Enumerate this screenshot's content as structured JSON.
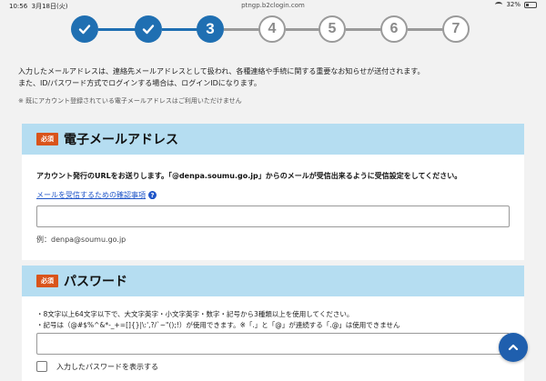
{
  "status_bar": {
    "time": "10:56",
    "date": "3月18日(火)",
    "url": "ptngp.b2clogin.com",
    "battery": "32%"
  },
  "stepper": {
    "steps": [
      "✓",
      "✓",
      "3",
      "4",
      "5",
      "6",
      "7"
    ],
    "current_step": 3,
    "colors": {
      "active": "#1f6fb2",
      "inactive": "#9a9a9a"
    }
  },
  "intro": {
    "line1": "入力したメールアドレスは、連絡先メールアドレスとして扱われ、各種連絡や手続に関する重要なお知らせが送付されます。",
    "line2": "また、ID/パスワード方式でログインする場合は、ログインIDになります。",
    "note": "※ 既にアカウント登録されている電子メールアドレスはご利用いただけません"
  },
  "email_section": {
    "required_badge": "必須",
    "title": "電子メールアドレス",
    "description": "アカウント発行のURLをお送りします。「@denpa.soumu.go.jp」からのメールが受信出来るように受信設定をしてください。",
    "link_text": "メールを受信するための確認事項",
    "help_icon": "?",
    "input_value": "",
    "example": "例：denpa@soumu.go.jp"
  },
  "password_section": {
    "required_badge": "必須",
    "title": "パスワード",
    "rule1": "・8文字以上64文字以下で、大文字英字・小文字英字・数字・記号から3種類以上を使用してください。",
    "rule2": "・記号は（@#$%^&*-_+=[]{}|\\:',?/`~\"();!）が使用できます。※「.」と「@」が連続する「.@」は使用できません",
    "input_value": "",
    "show_password_label": "入力したパスワードを表示する"
  },
  "colors": {
    "accent": "#1f6fb2",
    "section_header": "#b5ddf1",
    "required_badge": "#d9541b",
    "link": "#1f55c8"
  }
}
